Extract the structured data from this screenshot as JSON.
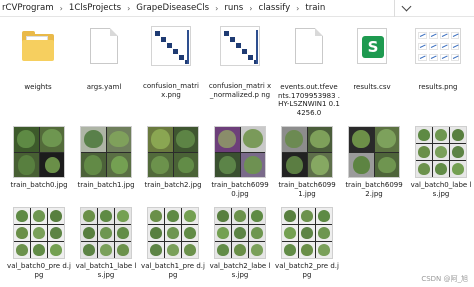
{
  "address": {
    "crumbs": [
      "rCVProgram",
      "1ClsProjects",
      "GrapeDiseaseCls",
      "runs",
      "classify",
      "train"
    ]
  },
  "files": [
    {
      "name": "weights",
      "kind": "folder"
    },
    {
      "name": "args.yaml",
      "kind": "file"
    },
    {
      "name": "confusion_matrix.png",
      "kind": "confusion"
    },
    {
      "name": "confusion_matrix_normalized.png",
      "kind": "confusion"
    },
    {
      "name": "events.out.tfevents.1709953983.HY-LSZNWIN1 0.14256.0",
      "kind": "file"
    },
    {
      "name": "results.csv",
      "kind": "csv"
    },
    {
      "name": "results.png",
      "kind": "resultsplot"
    },
    {
      "name": "train_batch0.jpg",
      "kind": "mosaic"
    },
    {
      "name": "train_batch1.jpg",
      "kind": "mosaic"
    },
    {
      "name": "train_batch2.jpg",
      "kind": "mosaic"
    },
    {
      "name": "train_batch60990.jpg",
      "kind": "mosaic"
    },
    {
      "name": "train_batch60991.jpg",
      "kind": "mosaic"
    },
    {
      "name": "train_batch60992.jpg",
      "kind": "mosaic"
    },
    {
      "name": "val_batch0_labels.jpg",
      "kind": "mosaic"
    },
    {
      "name": "val_batch0_pred.jpg",
      "kind": "mosaic"
    },
    {
      "name": "val_batch1_labels.jpg",
      "kind": "mosaic"
    },
    {
      "name": "val_batch1_pred.jpg",
      "kind": "mosaic"
    },
    {
      "name": "val_batch2_labels.jpg",
      "kind": "mosaic"
    },
    {
      "name": "val_batch2_pred.jpg",
      "kind": "mosaic"
    }
  ],
  "display_labels": {
    "weights": "weights",
    "args": "args.yaml",
    "cm": "confusion_matri x.png",
    "cmn": "confusion_matri x_normalized.p ng",
    "events": "events.out.tfeve nts.1709953983 .HY-LSZNWIN1 0.14256.0",
    "csv": "results.csv",
    "respng": "results.png",
    "tb0": "train_batch0.jpg",
    "tb1": "train_batch1.jpg",
    "tb2": "train_batch2.jpg",
    "tb60990": "train_batch6099 0.jpg",
    "tb60991": "train_batch6099 1.jpg",
    "tb60992": "train_batch6099 2.jpg",
    "vb0l": "val_batch0_labe ls.jpg",
    "vb0p": "val_batch0_pre d.jpg",
    "vb1l": "val_batch1_labe ls.jpg",
    "vb1p": "val_batch1_pre d.jpg",
    "vb2l": "val_batch2_labe ls.jpg",
    "vb2p": "val_batch2_pre d.jpg"
  },
  "icons": {
    "csv_letter": "S"
  },
  "watermark": "CSDN @阿_旭",
  "colors": {
    "folder": "#e9b949",
    "csv_green": "#1e9a50",
    "matrix_blue": "#1f3b73",
    "leaf_green": "#4f7a3a"
  }
}
